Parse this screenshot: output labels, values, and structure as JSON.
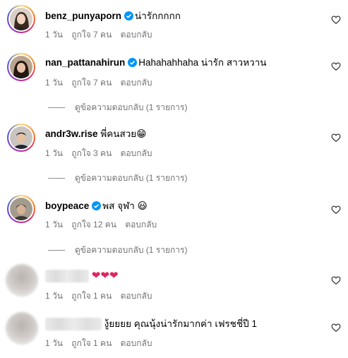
{
  "comments": [
    {
      "username": "benz_punyaporn",
      "verified": true,
      "text": "น่ารักกกกก",
      "time": "1 วัน",
      "likes": "ถูกใจ 7 คน",
      "reply": "ตอบกลับ",
      "view_replies": ""
    },
    {
      "username": "nan_pattanahirun",
      "verified": true,
      "text": "Hahahahhaha น่ารัก สาวหวาน",
      "time": "1 วัน",
      "likes": "ถูกใจ 7 คน",
      "reply": "ตอบกลับ",
      "view_replies": "ดูข้อความตอบกลับ (1 รายการ)"
    },
    {
      "username": "andr3w.rise",
      "verified": false,
      "text": "พี่คนสวย😁",
      "time": "1 วัน",
      "likes": "ถูกใจ 3 คน",
      "reply": "ตอบกลับ",
      "view_replies": "ดูข้อความตอบกลับ (1 รายการ)"
    },
    {
      "username": "boypeace",
      "verified": true,
      "text": "พส จุฬา 😃",
      "time": "1 วัน",
      "likes": "ถูกใจ 12 คน",
      "reply": "ตอบกลับ",
      "view_replies": "ดูข้อความตอบกลับ (1 รายการ)"
    },
    {
      "username": "",
      "verified": false,
      "text": "❤❤❤",
      "time": "1 วัน",
      "likes": "ถูกใจ 1 คน",
      "reply": "ตอบกลับ",
      "view_replies": ""
    },
    {
      "username": "",
      "verified": false,
      "text": "งู้ยยยย คุณนุ้งน่ารักมากค่า เฟรชชี่ปี 1",
      "time": "1 วัน",
      "likes": "ถูกใจ 1 คน",
      "reply": "ตอบกลับ",
      "view_replies": ""
    }
  ],
  "icons": {
    "like": "heart-outline-icon",
    "verified": "verified-badge-icon"
  },
  "colors": {
    "verified_blue": "#0095f6",
    "meta_gray": "#737373",
    "heart_red": "#e0245e"
  }
}
